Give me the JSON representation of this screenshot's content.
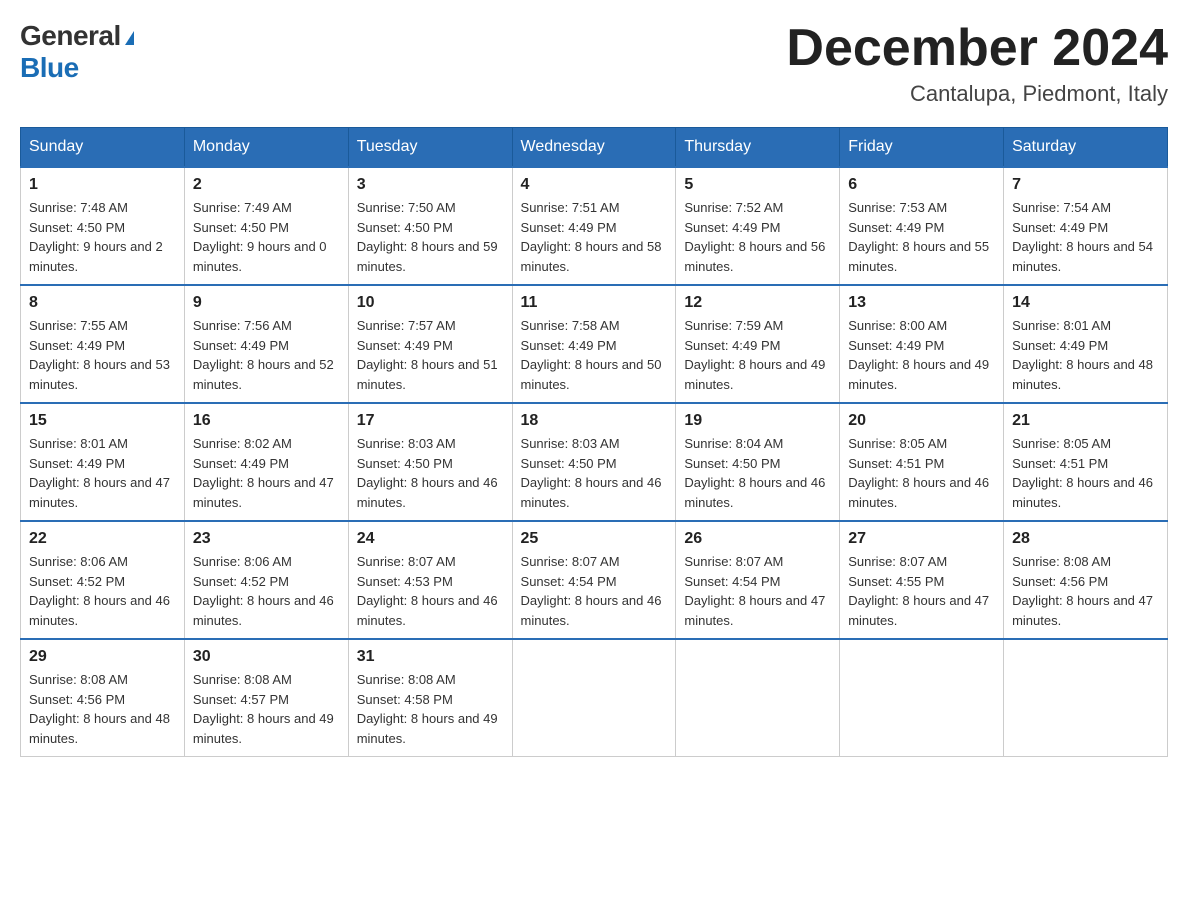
{
  "logo": {
    "general": "General",
    "blue": "Blue",
    "triangle": "▲"
  },
  "header": {
    "month_year": "December 2024",
    "location": "Cantalupa, Piedmont, Italy"
  },
  "columns": [
    "Sunday",
    "Monday",
    "Tuesday",
    "Wednesday",
    "Thursday",
    "Friday",
    "Saturday"
  ],
  "weeks": [
    [
      {
        "day": "1",
        "sunrise": "7:48 AM",
        "sunset": "4:50 PM",
        "daylight": "9 hours and 2 minutes."
      },
      {
        "day": "2",
        "sunrise": "7:49 AM",
        "sunset": "4:50 PM",
        "daylight": "9 hours and 0 minutes."
      },
      {
        "day": "3",
        "sunrise": "7:50 AM",
        "sunset": "4:50 PM",
        "daylight": "8 hours and 59 minutes."
      },
      {
        "day": "4",
        "sunrise": "7:51 AM",
        "sunset": "4:49 PM",
        "daylight": "8 hours and 58 minutes."
      },
      {
        "day": "5",
        "sunrise": "7:52 AM",
        "sunset": "4:49 PM",
        "daylight": "8 hours and 56 minutes."
      },
      {
        "day": "6",
        "sunrise": "7:53 AM",
        "sunset": "4:49 PM",
        "daylight": "8 hours and 55 minutes."
      },
      {
        "day": "7",
        "sunrise": "7:54 AM",
        "sunset": "4:49 PM",
        "daylight": "8 hours and 54 minutes."
      }
    ],
    [
      {
        "day": "8",
        "sunrise": "7:55 AM",
        "sunset": "4:49 PM",
        "daylight": "8 hours and 53 minutes."
      },
      {
        "day": "9",
        "sunrise": "7:56 AM",
        "sunset": "4:49 PM",
        "daylight": "8 hours and 52 minutes."
      },
      {
        "day": "10",
        "sunrise": "7:57 AM",
        "sunset": "4:49 PM",
        "daylight": "8 hours and 51 minutes."
      },
      {
        "day": "11",
        "sunrise": "7:58 AM",
        "sunset": "4:49 PM",
        "daylight": "8 hours and 50 minutes."
      },
      {
        "day": "12",
        "sunrise": "7:59 AM",
        "sunset": "4:49 PM",
        "daylight": "8 hours and 49 minutes."
      },
      {
        "day": "13",
        "sunrise": "8:00 AM",
        "sunset": "4:49 PM",
        "daylight": "8 hours and 49 minutes."
      },
      {
        "day": "14",
        "sunrise": "8:01 AM",
        "sunset": "4:49 PM",
        "daylight": "8 hours and 48 minutes."
      }
    ],
    [
      {
        "day": "15",
        "sunrise": "8:01 AM",
        "sunset": "4:49 PM",
        "daylight": "8 hours and 47 minutes."
      },
      {
        "day": "16",
        "sunrise": "8:02 AM",
        "sunset": "4:49 PM",
        "daylight": "8 hours and 47 minutes."
      },
      {
        "day": "17",
        "sunrise": "8:03 AM",
        "sunset": "4:50 PM",
        "daylight": "8 hours and 46 minutes."
      },
      {
        "day": "18",
        "sunrise": "8:03 AM",
        "sunset": "4:50 PM",
        "daylight": "8 hours and 46 minutes."
      },
      {
        "day": "19",
        "sunrise": "8:04 AM",
        "sunset": "4:50 PM",
        "daylight": "8 hours and 46 minutes."
      },
      {
        "day": "20",
        "sunrise": "8:05 AM",
        "sunset": "4:51 PM",
        "daylight": "8 hours and 46 minutes."
      },
      {
        "day": "21",
        "sunrise": "8:05 AM",
        "sunset": "4:51 PM",
        "daylight": "8 hours and 46 minutes."
      }
    ],
    [
      {
        "day": "22",
        "sunrise": "8:06 AM",
        "sunset": "4:52 PM",
        "daylight": "8 hours and 46 minutes."
      },
      {
        "day": "23",
        "sunrise": "8:06 AM",
        "sunset": "4:52 PM",
        "daylight": "8 hours and 46 minutes."
      },
      {
        "day": "24",
        "sunrise": "8:07 AM",
        "sunset": "4:53 PM",
        "daylight": "8 hours and 46 minutes."
      },
      {
        "day": "25",
        "sunrise": "8:07 AM",
        "sunset": "4:54 PM",
        "daylight": "8 hours and 46 minutes."
      },
      {
        "day": "26",
        "sunrise": "8:07 AM",
        "sunset": "4:54 PM",
        "daylight": "8 hours and 47 minutes."
      },
      {
        "day": "27",
        "sunrise": "8:07 AM",
        "sunset": "4:55 PM",
        "daylight": "8 hours and 47 minutes."
      },
      {
        "day": "28",
        "sunrise": "8:08 AM",
        "sunset": "4:56 PM",
        "daylight": "8 hours and 47 minutes."
      }
    ],
    [
      {
        "day": "29",
        "sunrise": "8:08 AM",
        "sunset": "4:56 PM",
        "daylight": "8 hours and 48 minutes."
      },
      {
        "day": "30",
        "sunrise": "8:08 AM",
        "sunset": "4:57 PM",
        "daylight": "8 hours and 49 minutes."
      },
      {
        "day": "31",
        "sunrise": "8:08 AM",
        "sunset": "4:58 PM",
        "daylight": "8 hours and 49 minutes."
      },
      null,
      null,
      null,
      null
    ]
  ]
}
